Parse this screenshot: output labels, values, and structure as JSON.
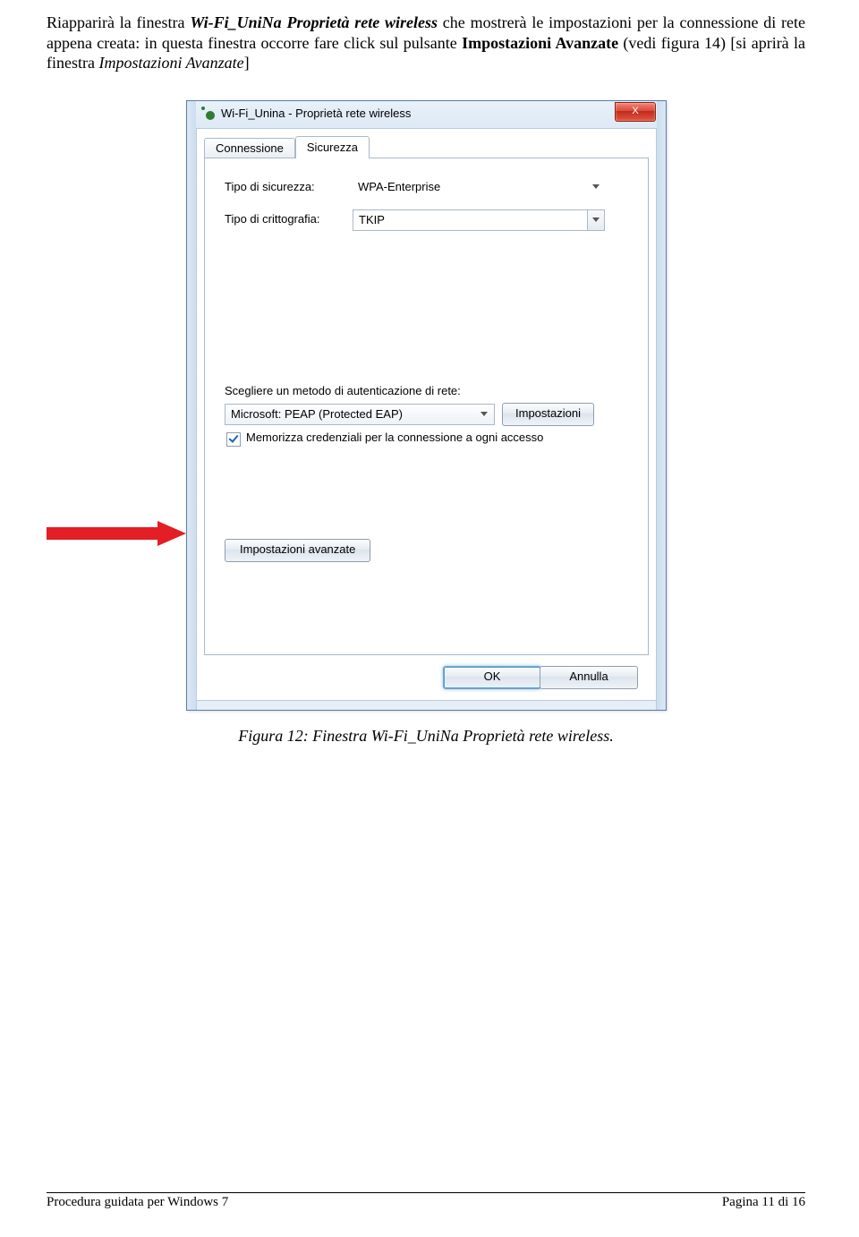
{
  "paragraph": {
    "t1": "Riapparirà la finestra ",
    "t2": "Wi-Fi_UniNa Proprietà rete wireless",
    "t3": " che mostrerà le impostazioni per la connessione di rete appena creata: in questa finestra occorre fare click sul pulsante ",
    "t4": "Impostazioni Avanzate",
    "t5": " (vedi figura 14) [si aprirà la finestra ",
    "t6": "Impostazioni Avanzate",
    "t7": "]"
  },
  "dialog": {
    "title": "Wi-Fi_Unina - Proprietà rete wireless",
    "close_label": "X",
    "tabs": {
      "connessione": "Connessione",
      "sicurezza": "Sicurezza"
    },
    "security_type_label": "Tipo di sicurezza:",
    "security_type_value": "WPA-Enterprise",
    "encryption_label": "Tipo di crittografia:",
    "encryption_value": "TKIP",
    "auth_method_caption": "Scegliere un metodo di autenticazione di rete:",
    "auth_method_value": "Microsoft: PEAP (Protected EAP)",
    "settings_btn": "Impostazioni",
    "remember_label": "Memorizza credenziali per la connessione a ogni accesso",
    "advanced_btn": "Impostazioni avanzate",
    "ok_btn": "OK",
    "cancel_btn": "Annulla"
  },
  "caption": "Figura 12: Finestra Wi-Fi_UniNa Proprietà rete wireless.",
  "footer": {
    "left": "Procedura guidata per Windows 7",
    "right": "Pagina 11 di 16"
  }
}
